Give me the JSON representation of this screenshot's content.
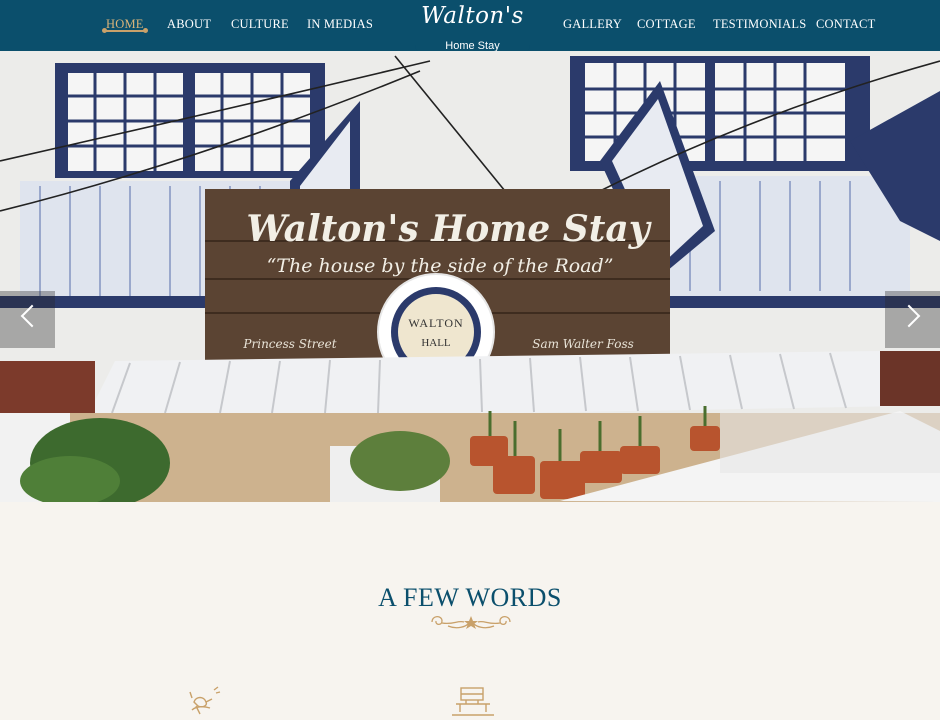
{
  "nav": {
    "left": [
      "HOME",
      "ABOUT",
      "CULTURE",
      "IN MEDIAS"
    ],
    "right": [
      "GALLERY",
      "COTTAGE",
      "TESTIMONIALS",
      "CONTACT"
    ],
    "active": "HOME"
  },
  "logo": {
    "script": "Walton's",
    "subtitle": "Home Stay"
  },
  "hero": {
    "sign_title": "Walton's Home Stay",
    "sign_tagline": "“The house by the side of the Road”",
    "sign_left": "Princess Street",
    "sign_right": "Sam Walter Foss",
    "plaque_top": "WALTON",
    "plaque_bottom": "HALL"
  },
  "section": {
    "title": "A FEW WORDS"
  },
  "features": [
    {
      "icon": "bird-on-branch-icon"
    },
    {
      "icon": "cottage-bench-icon"
    }
  ],
  "colors": {
    "brand": "#0b4f6c",
    "accent": "#c9a16a",
    "background": "#f7f4ef"
  }
}
